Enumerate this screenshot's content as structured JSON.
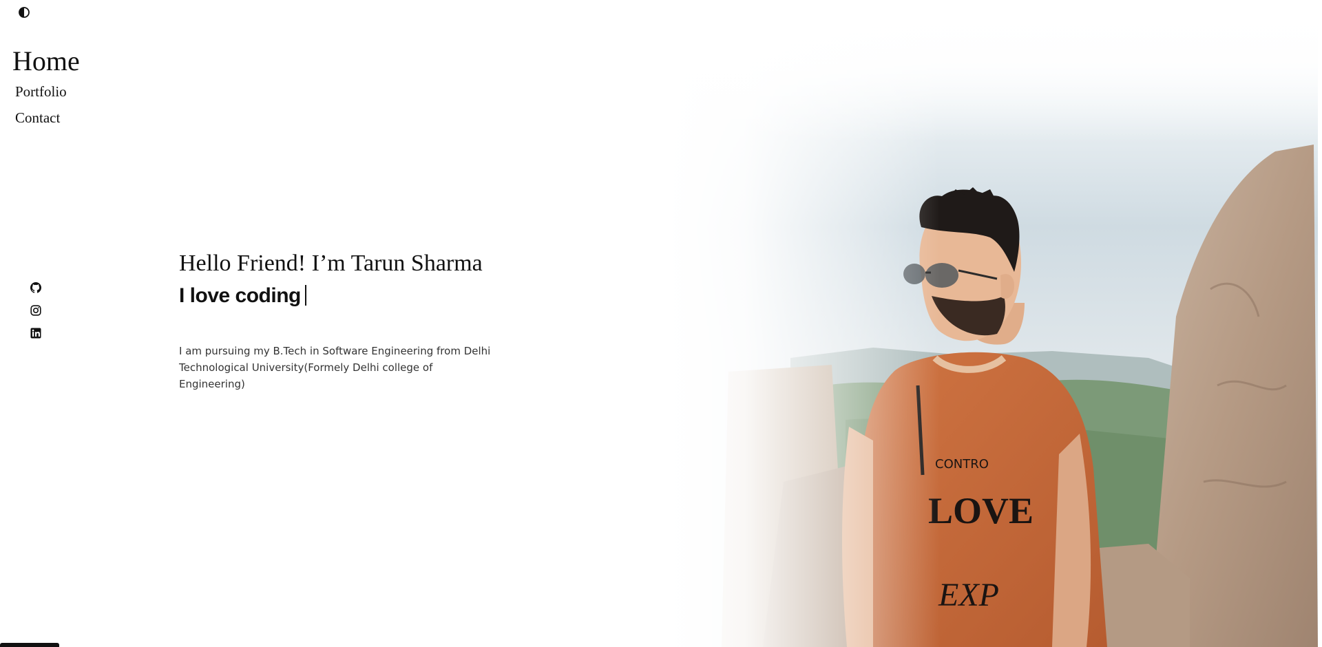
{
  "theme_toggle": {
    "icon": "half-circle-contrast-icon"
  },
  "nav": {
    "home_label": "Home",
    "items": [
      {
        "label": "Portfolio"
      },
      {
        "label": "Contact"
      }
    ]
  },
  "social": [
    {
      "icon": "github-icon"
    },
    {
      "icon": "instagram-icon"
    },
    {
      "icon": "linkedin-icon"
    }
  ],
  "hero": {
    "greeting": "Hello Friend! I’m Tarun Sharma",
    "tagline": "I love coding",
    "bio": "I am pursuing my B.Tech in Software Engineering from Delhi Technological University(Formely Delhi college of Engineering)"
  },
  "colors": {
    "shirt": "#c8693a",
    "sky": "#cfdbe2",
    "rock": "#b9a08a",
    "text": "#111111"
  }
}
